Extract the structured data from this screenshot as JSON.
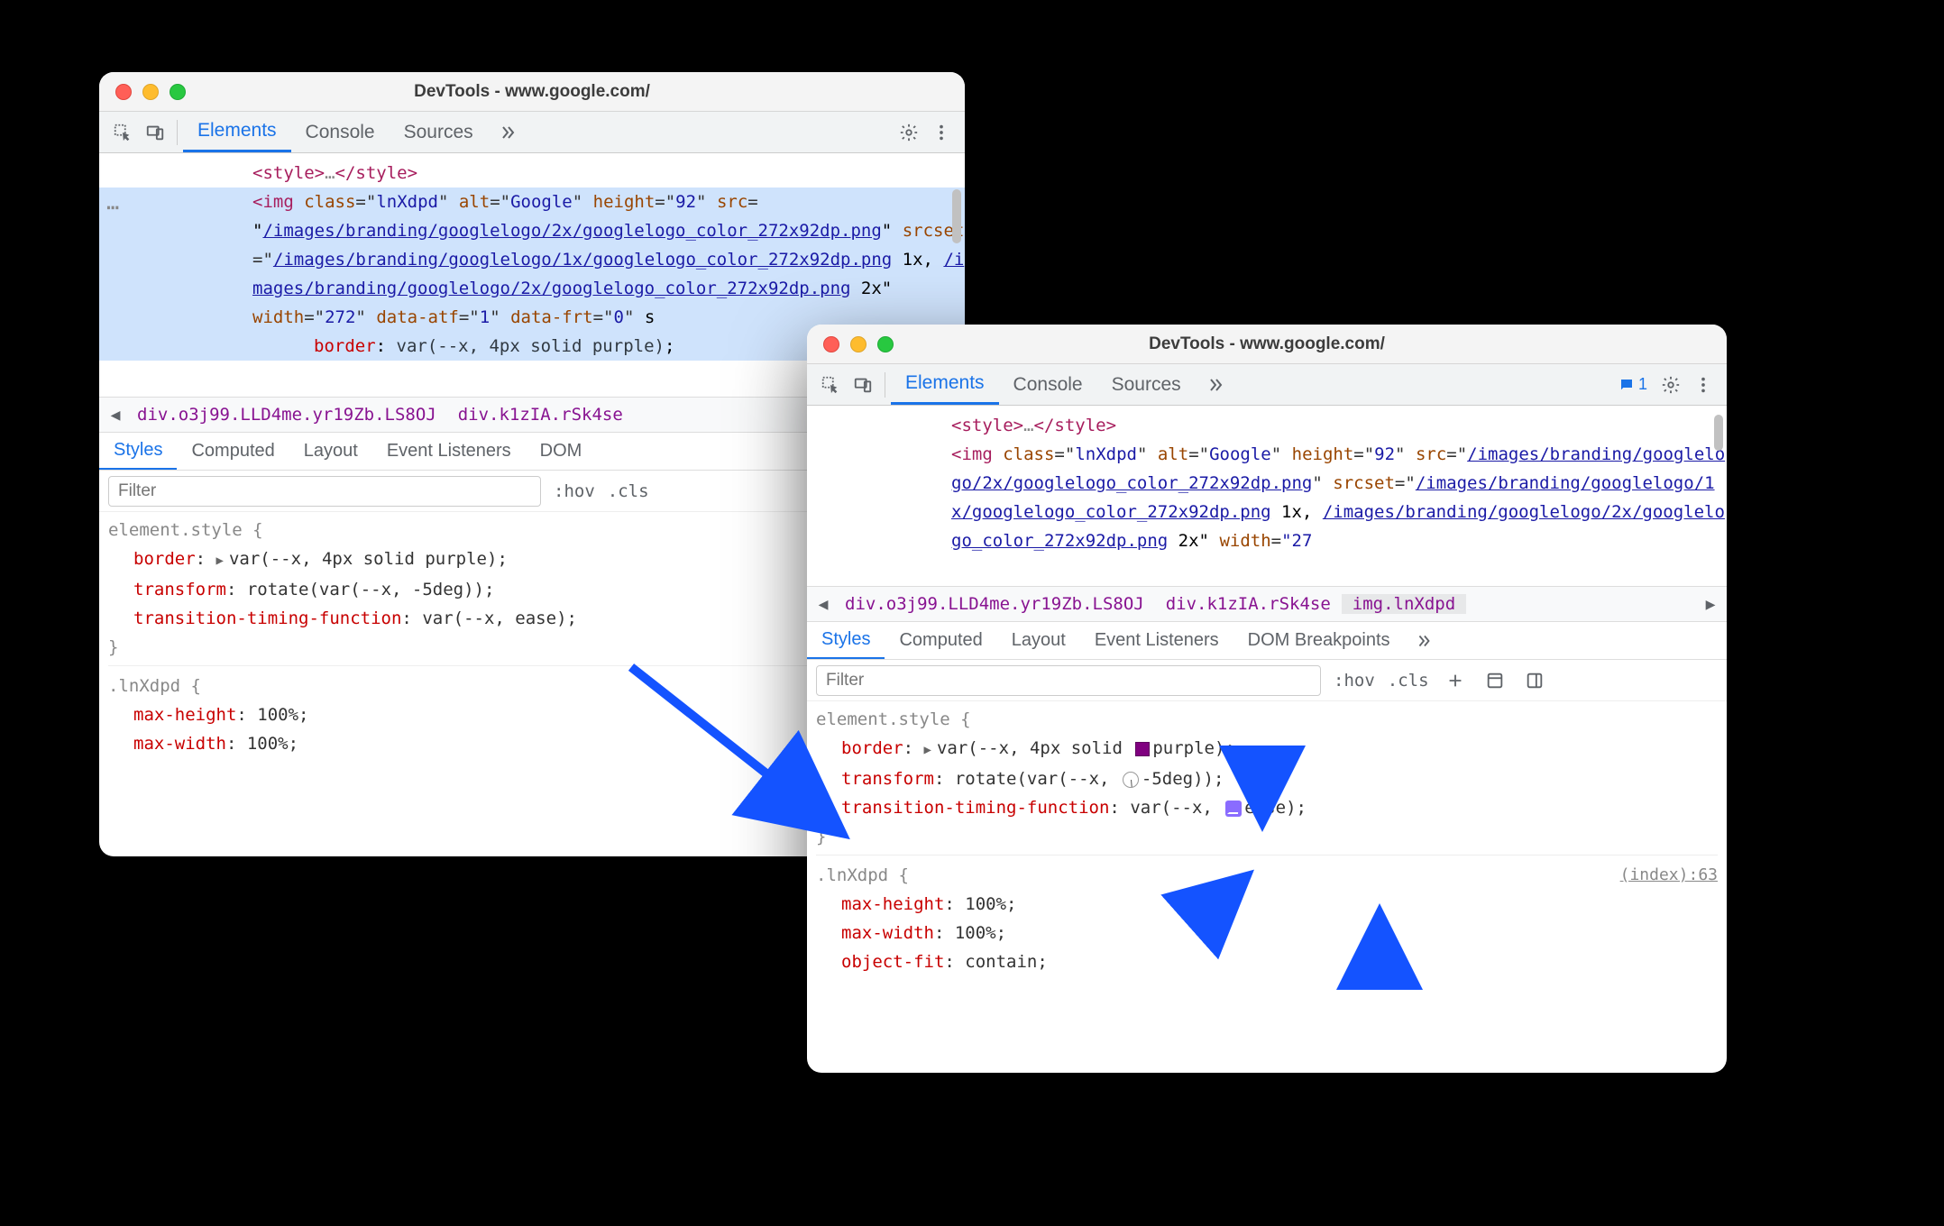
{
  "window_title": "DevTools - www.google.com/",
  "tabs": {
    "elements": "Elements",
    "console": "Console",
    "sources": "Sources"
  },
  "dom": {
    "style_close": "<style>…</style>",
    "img_open1": "<img",
    "class_attr": "class",
    "class_val": "lnXdpd",
    "alt_attr": "alt",
    "alt_val": "Google",
    "height_attr": "height",
    "height_val": "92",
    "src_attr": "src",
    "src_val": "/images/branding/googlelogo/2x/googlelogo_color_272x92dp.png",
    "srcset_attr": "srcset",
    "srcset_val1": "/images/branding/googlelogo/1x/googlelogo_color_272x92dp.png",
    "srcset_mult1": " 1x, ",
    "srcset_val2": "/images/branding/googlelogo/2x/googlelogo_color_272x92dp.png",
    "srcset_mult2_a": " 2x\"",
    "width_attr": "width",
    "width_val": "272",
    "dataatf_attr": "data-atf",
    "dataatf_val": "1",
    "datafrt_attr": "data-frt",
    "datafrt_val": "0",
    "inline_style_label": "border",
    "inline_style_value": "var(--x, 4px solid purple)",
    "w2_width_trail": "\"27"
  },
  "crumbs": {
    "c1": "div.o3j99.LLD4me.yr19Zb.LS8OJ",
    "c2": "div.k1zIA.rSk4se",
    "c3": "img.lnXdpd"
  },
  "subtabs": {
    "styles": "Styles",
    "computed": "Computed",
    "layout": "Layout",
    "listeners": "Event Listeners",
    "dom_short": "DOM ",
    "dombp": "DOM Breakpoints"
  },
  "filter_placeholder": "Filter",
  "hov": ":hov",
  "cls": ".cls",
  "element_style": "element.style {",
  "brace_close": "}",
  "props": {
    "border": {
      "n": "border",
      "v_prefix": "▶ var(",
      "flagA": "--x",
      "flagB": ", 4px solid ",
      "flagC": "purple",
      "tail": ");"
    },
    "transform": {
      "n": "transform",
      "v_prefix": "rotate(var(",
      "flagA": "--x",
      "flagB": ", ",
      "flagC": "-5deg",
      "tail": "));"
    },
    "ttf": {
      "n": "transition-timing-function",
      "v_prefix": "var(",
      "flagA": "--x",
      "flagB": ", ",
      "flagC": "ease",
      "tail": ");"
    }
  },
  "rule2_selector": ".lnXdpd {",
  "rule2_p1n": "max-height",
  "rule2_p1v": "100%;",
  "rule2_p2n": "max-width",
  "rule2_p2v": "100%;",
  "rule2_p3n": "object-fit",
  "rule2_p3v": "contain;",
  "source_link": "(index):63",
  "messages_badge": "1"
}
